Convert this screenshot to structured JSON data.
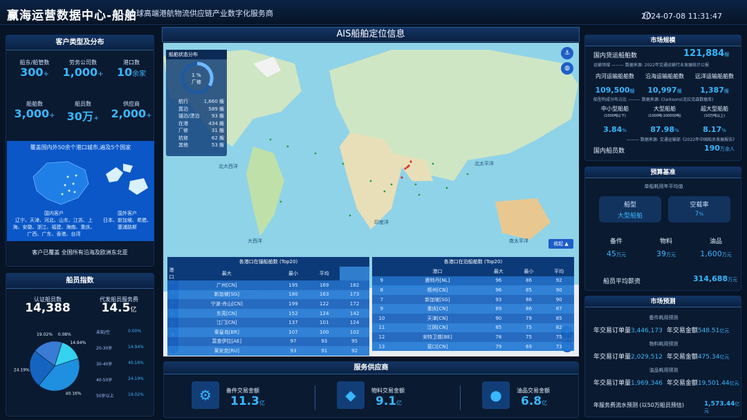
{
  "header": {
    "title": "赢海运营数据中心-船舶",
    "subtitle": "全球高端港航物流供应链产业数字化服务商",
    "datetime": "2024-07-08 11:31:47"
  },
  "left": {
    "customer_panel": {
      "title": "客户类型及分布",
      "stats": [
        {
          "label": "船东/船管数",
          "value": "300",
          "suffix": "+"
        },
        {
          "label": "劳务公司数",
          "value": "1,000",
          "suffix": "+"
        },
        {
          "label": "港口数",
          "value": "10",
          "suffix": "余家"
        },
        {
          "label": "船舶数",
          "value": "3,000",
          "suffix": "+"
        },
        {
          "label": "船员数",
          "value": "30万",
          "suffix": "+"
        },
        {
          "label": "供应商",
          "value": "2,000",
          "suffix": "+"
        }
      ],
      "map_caption": "覆盖国内外50余个港口城市,遍及5个国家",
      "domestic_title": "国内客户",
      "domestic_list": "辽宁、天津、河北、山东、江苏、上海、安徽、浙江、福建、海南、重庆、广西、广东、香港、台湾",
      "foreign_title": "国外客户",
      "foreign_list": "日本、新加坡、希腊、塞浦路斯",
      "footer": "客户已覆盖 全国所有沿海及欧洲东北亚"
    },
    "crew_panel": {
      "title": "船员指数",
      "cert_label": "认证船员数",
      "cert_value": "14,388",
      "pay_label": "代发船员服务费",
      "pay_value": "14.5",
      "pay_unit": "亿",
      "legend": [
        {
          "range": "未知/空",
          "pct": "0.00%"
        },
        {
          "range": "20-30岁",
          "pct": "14.94%"
        },
        {
          "range": "30-40岁",
          "pct": "40.16%"
        },
        {
          "range": "40-50岁",
          "pct": "24.19%"
        },
        {
          "range": "50岁以上",
          "pct": "19.02%"
        }
      ]
    }
  },
  "chart_data": {
    "type": "pie",
    "title": "",
    "categories": [
      "未知/空",
      "20-30岁",
      "30-40岁",
      "40-50岁",
      "50岁以上"
    ],
    "values": [
      0.08,
      14.94,
      40.16,
      24.19,
      19.02
    ],
    "slice_labels": [
      "0.08%",
      "14.94%",
      "40.16%",
      "24.19%",
      "19.02%"
    ],
    "colors": [
      "#7fe7ff",
      "#35d2f0",
      "#1f8fe0",
      "#1565c0",
      "#3a7bd5"
    ]
  },
  "center": {
    "map_title": "AIS船舶定位信息",
    "status": {
      "title": "船舶状态分布",
      "ring_label1": "1 %",
      "ring_label2": "厂修",
      "rows": [
        {
          "k": "航行",
          "v": "1,660 艘"
        },
        {
          "k": "靠泊",
          "v": "589 艘"
        },
        {
          "k": "锚泊/漂泊",
          "v": "93 艘"
        },
        {
          "k": "在港",
          "v": "434 艘"
        },
        {
          "k": "厂修",
          "v": "31 艘"
        },
        {
          "k": "抗修",
          "v": "62 艘"
        },
        {
          "k": "其他",
          "v": "53 艘"
        }
      ]
    },
    "ocean_labels": [
      "北大西洋",
      "北太平洋",
      "北太平洋",
      "印度洋",
      "南太平洋",
      "大西洋",
      "南太平洋"
    ],
    "collapse_label": "收起 ▲",
    "top_in": {
      "title": "各港口在锚船舶数 (Top20)",
      "headers": [
        "港口",
        "最大",
        "最小",
        "平均"
      ],
      "rows": [
        [
          "广州[CN]",
          "195",
          "169",
          "182"
        ],
        [
          "新加坡[SG]",
          "180",
          "163",
          "173"
        ],
        [
          "宁波-舟山[CN]",
          "199",
          "122",
          "172"
        ],
        [
          "东莞[CN]",
          "152",
          "124",
          "142"
        ],
        [
          "江门[CN]",
          "137",
          "101",
          "124"
        ],
        [
          "秦皇岛[BR]",
          "107",
          "100",
          "102"
        ],
        [
          "富查伊拉[AE]",
          "97",
          "93",
          "95"
        ],
        [
          "莱安克[RU]",
          "93",
          "91",
          "92"
        ]
      ]
    },
    "top_near": {
      "title": "各港口在泊船舶数 (Top20)",
      "headers": [
        "港口",
        "最大",
        "最小",
        "平均"
      ],
      "rows": [
        [
          "9",
          "鹿特丹[NL]",
          "96",
          "86",
          "92"
        ],
        [
          "8",
          "梧州[CN]",
          "96",
          "85",
          "90"
        ],
        [
          "7",
          "新加坡[SG]",
          "93",
          "86",
          "90"
        ],
        [
          "9",
          "重庆[CN]",
          "89",
          "86",
          "87"
        ],
        [
          "10",
          "天津[CN]",
          "90",
          "79",
          "85"
        ],
        [
          "11",
          "江阴[CN]",
          "85",
          "75",
          "82"
        ],
        [
          "12",
          "安特卫普[BE]",
          "78",
          "75",
          "75"
        ],
        [
          "13",
          "营口[CN]",
          "79",
          "69",
          "73"
        ]
      ]
    },
    "service": {
      "title": "服务供应商",
      "items": [
        {
          "label": "备件交易金额",
          "value": "11.3",
          "unit": "亿"
        },
        {
          "label": "物料交易金额",
          "value": "9.1",
          "unit": "亿"
        },
        {
          "label": "油品交易金额",
          "value": "6.8",
          "unit": "亿"
        }
      ]
    }
  },
  "right": {
    "market": {
      "title": "市场规模",
      "domestic_label": "国内货运船舶数",
      "domestic_value": "121,884",
      "domestic_unit": "艘",
      "source1": "运输领域 ——— 数据来源: 2022年交通运输行业发展统计公报",
      "three": [
        {
          "label": "内河运输船舶数",
          "value": "109,500",
          "unit": "艘"
        },
        {
          "label": "沿海运输船舶数",
          "value": "10,997",
          "unit": "艘"
        },
        {
          "label": "远洋运输船舶数",
          "value": "1,387",
          "unit": "艘"
        }
      ],
      "source2": "船型构成分布占比 ——— 数据来源: Clarksons(克拉克森数据库)",
      "sizes": [
        {
          "label": "中小型船舶",
          "sub": "(1000吨以下)",
          "value": "3.84",
          "unit": "%"
        },
        {
          "label": "大型船舶",
          "sub": "(1000吨-100000吨)",
          "value": "87.98",
          "unit": "%"
        },
        {
          "label": "超大型船舶",
          "sub": "(10万吨以上)",
          "value": "8.17",
          "unit": "%"
        }
      ],
      "source3": "——— 数据来源: 交通运输部《2022年中国船员发展报告》",
      "crew_label": "国内船员数",
      "crew_value": "190",
      "crew_unit": "万余人"
    },
    "forecast_base": {
      "title": "预算基准",
      "subtitle": "单船耗用年平均值",
      "ship_label": "船型",
      "ship_value": "大型船舶",
      "empty_label": "空载率",
      "empty_value": "7",
      "empty_unit": "%",
      "trio": [
        {
          "label": "备件",
          "value": "45",
          "unit": "万元"
        },
        {
          "label": "物料",
          "value": "39",
          "unit": "万元"
        },
        {
          "label": "油品",
          "value": "1,600",
          "unit": "万元"
        }
      ],
      "salary_label": "船员平均薪资",
      "salary_value": "314,688",
      "salary_unit": "万元"
    },
    "market_forecast": {
      "title": "市场预测",
      "groups": [
        {
          "head": "备件耗用预测",
          "orders": "3,446,173",
          "amount": "548.51"
        },
        {
          "head": "物料耗用预测",
          "orders": "2,029,512",
          "amount": "475.34"
        },
        {
          "head": "油品耗用预测",
          "orders": "1,969,346",
          "amount": "19,501.44"
        }
      ],
      "orders_label": "年交易订单量",
      "amount_label": "年交易金额",
      "amount_unit": "亿元",
      "total_label": "年服务费流水预测 (以50万船员预估)",
      "total_value": "1,573.44",
      "total_unit": "亿元"
    }
  }
}
